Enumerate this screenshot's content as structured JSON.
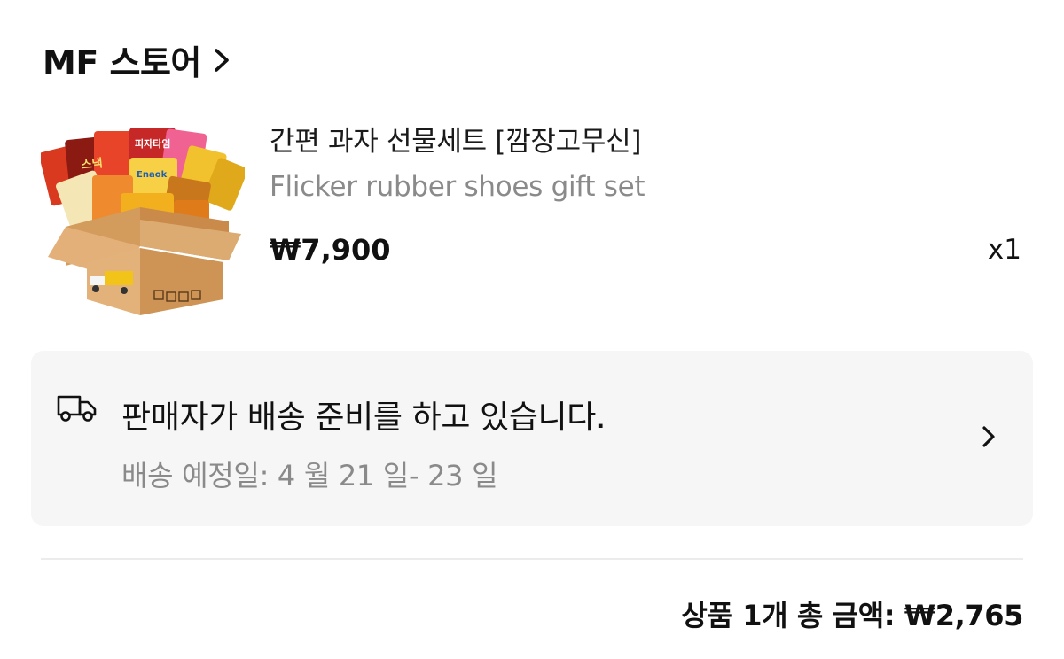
{
  "store": {
    "name": "MF 스토어",
    "chevron_icon": "chevron-right-icon"
  },
  "product": {
    "title": "간편 과자 선물세트 [깜장고무신]",
    "subtitle": "Flicker rubber shoes gift set",
    "price": "₩7,900",
    "quantity": "x1",
    "image_icon": "snack-box-image"
  },
  "shipping": {
    "icon": "truck-icon",
    "status": "판매자가 배송 준비를 하고 있습니다.",
    "estimate": "배송 예정일: 4 월 21 일- 23 일",
    "chevron_icon": "chevron-right-icon"
  },
  "summary": {
    "total": "상품 1개 총 금액: ₩2,765"
  },
  "colors": {
    "card_bg": "#f6f6f6",
    "muted_text": "#8a8a8a",
    "divider": "#ececec"
  }
}
